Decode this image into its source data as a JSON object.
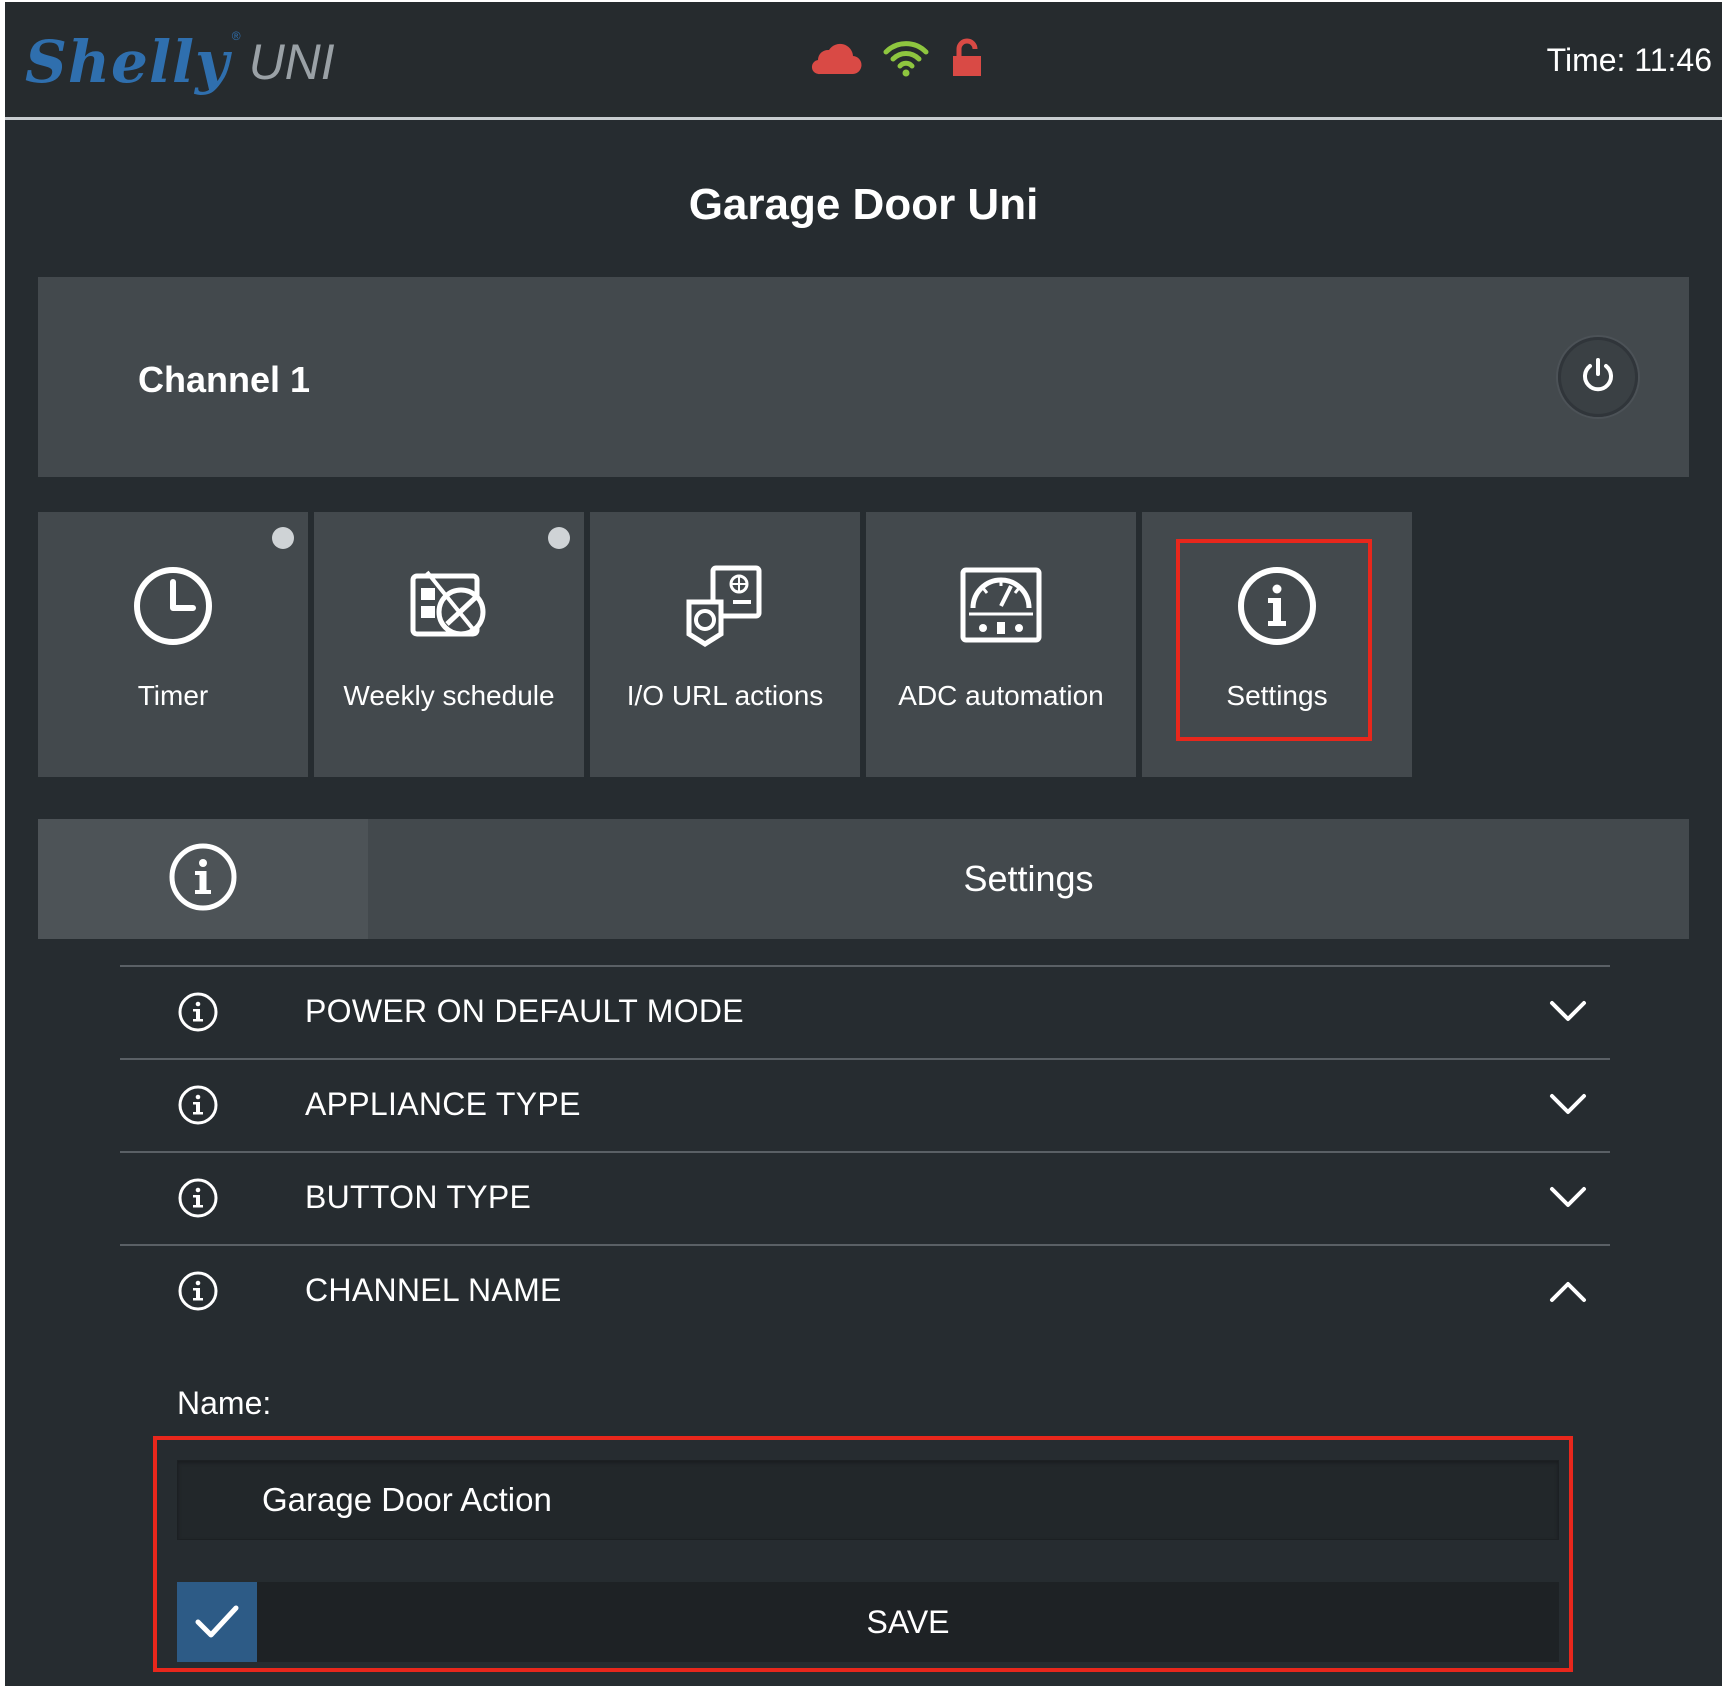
{
  "header": {
    "brand": "Shelly",
    "brand_mark": "®",
    "model": "UNI",
    "time": "Time: 11:46",
    "status_icons": [
      "cloud-icon",
      "wifi-icon",
      "unlocked-padlock-icon"
    ],
    "colors": {
      "cloud": "#d94a45",
      "wifi": "#8ec63f",
      "lock": "#d94a45",
      "brand": "#2f6fae"
    }
  },
  "page": {
    "title": "Garage Door Uni"
  },
  "channel": {
    "label": "Channel  1",
    "power_icon": "power-icon"
  },
  "tiles": [
    {
      "label": "Timer",
      "icon": "clock-icon",
      "indicator": true
    },
    {
      "label": "Weekly schedule",
      "icon": "weekly-schedule-icon",
      "indicator": true
    },
    {
      "label": "I/O URL actions",
      "icon": "io-url-actions-icon",
      "indicator": false
    },
    {
      "label": "ADC automation",
      "icon": "adc-gauge-icon",
      "indicator": false
    },
    {
      "label": "Settings",
      "icon": "info-icon",
      "indicator": false,
      "highlighted": true
    }
  ],
  "section": {
    "title": "Settings",
    "icon": "info-icon"
  },
  "settings": [
    {
      "label": "POWER ON DEFAULT MODE",
      "expanded": false
    },
    {
      "label": "APPLIANCE TYPE",
      "expanded": false
    },
    {
      "label": "BUTTON TYPE",
      "expanded": false
    },
    {
      "label": "CHANNEL NAME",
      "expanded": true
    }
  ],
  "channel_name_form": {
    "label": "Name:",
    "value": "Garage Door Action",
    "save_label": "SAVE",
    "highlight_color": "#e8271c"
  }
}
